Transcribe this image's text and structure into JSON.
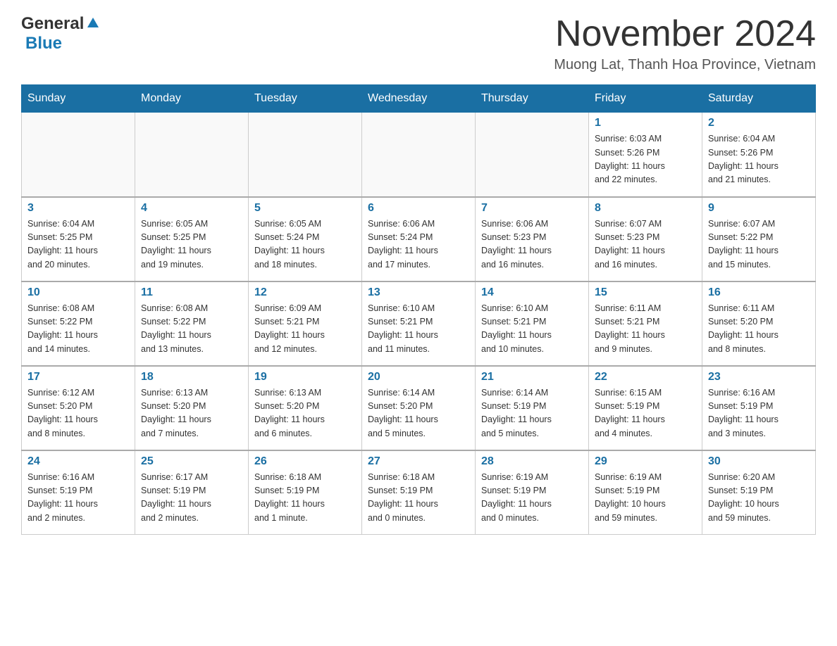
{
  "logo": {
    "text_general": "General",
    "text_blue": "Blue"
  },
  "header": {
    "month_year": "November 2024",
    "location": "Muong Lat, Thanh Hoa Province, Vietnam"
  },
  "weekdays": [
    "Sunday",
    "Monday",
    "Tuesday",
    "Wednesday",
    "Thursday",
    "Friday",
    "Saturday"
  ],
  "weeks": [
    [
      {
        "day": "",
        "info": ""
      },
      {
        "day": "",
        "info": ""
      },
      {
        "day": "",
        "info": ""
      },
      {
        "day": "",
        "info": ""
      },
      {
        "day": "",
        "info": ""
      },
      {
        "day": "1",
        "info": "Sunrise: 6:03 AM\nSunset: 5:26 PM\nDaylight: 11 hours\nand 22 minutes."
      },
      {
        "day": "2",
        "info": "Sunrise: 6:04 AM\nSunset: 5:26 PM\nDaylight: 11 hours\nand 21 minutes."
      }
    ],
    [
      {
        "day": "3",
        "info": "Sunrise: 6:04 AM\nSunset: 5:25 PM\nDaylight: 11 hours\nand 20 minutes."
      },
      {
        "day": "4",
        "info": "Sunrise: 6:05 AM\nSunset: 5:25 PM\nDaylight: 11 hours\nand 19 minutes."
      },
      {
        "day": "5",
        "info": "Sunrise: 6:05 AM\nSunset: 5:24 PM\nDaylight: 11 hours\nand 18 minutes."
      },
      {
        "day": "6",
        "info": "Sunrise: 6:06 AM\nSunset: 5:24 PM\nDaylight: 11 hours\nand 17 minutes."
      },
      {
        "day": "7",
        "info": "Sunrise: 6:06 AM\nSunset: 5:23 PM\nDaylight: 11 hours\nand 16 minutes."
      },
      {
        "day": "8",
        "info": "Sunrise: 6:07 AM\nSunset: 5:23 PM\nDaylight: 11 hours\nand 16 minutes."
      },
      {
        "day": "9",
        "info": "Sunrise: 6:07 AM\nSunset: 5:22 PM\nDaylight: 11 hours\nand 15 minutes."
      }
    ],
    [
      {
        "day": "10",
        "info": "Sunrise: 6:08 AM\nSunset: 5:22 PM\nDaylight: 11 hours\nand 14 minutes."
      },
      {
        "day": "11",
        "info": "Sunrise: 6:08 AM\nSunset: 5:22 PM\nDaylight: 11 hours\nand 13 minutes."
      },
      {
        "day": "12",
        "info": "Sunrise: 6:09 AM\nSunset: 5:21 PM\nDaylight: 11 hours\nand 12 minutes."
      },
      {
        "day": "13",
        "info": "Sunrise: 6:10 AM\nSunset: 5:21 PM\nDaylight: 11 hours\nand 11 minutes."
      },
      {
        "day": "14",
        "info": "Sunrise: 6:10 AM\nSunset: 5:21 PM\nDaylight: 11 hours\nand 10 minutes."
      },
      {
        "day": "15",
        "info": "Sunrise: 6:11 AM\nSunset: 5:21 PM\nDaylight: 11 hours\nand 9 minutes."
      },
      {
        "day": "16",
        "info": "Sunrise: 6:11 AM\nSunset: 5:20 PM\nDaylight: 11 hours\nand 8 minutes."
      }
    ],
    [
      {
        "day": "17",
        "info": "Sunrise: 6:12 AM\nSunset: 5:20 PM\nDaylight: 11 hours\nand 8 minutes."
      },
      {
        "day": "18",
        "info": "Sunrise: 6:13 AM\nSunset: 5:20 PM\nDaylight: 11 hours\nand 7 minutes."
      },
      {
        "day": "19",
        "info": "Sunrise: 6:13 AM\nSunset: 5:20 PM\nDaylight: 11 hours\nand 6 minutes."
      },
      {
        "day": "20",
        "info": "Sunrise: 6:14 AM\nSunset: 5:20 PM\nDaylight: 11 hours\nand 5 minutes."
      },
      {
        "day": "21",
        "info": "Sunrise: 6:14 AM\nSunset: 5:19 PM\nDaylight: 11 hours\nand 5 minutes."
      },
      {
        "day": "22",
        "info": "Sunrise: 6:15 AM\nSunset: 5:19 PM\nDaylight: 11 hours\nand 4 minutes."
      },
      {
        "day": "23",
        "info": "Sunrise: 6:16 AM\nSunset: 5:19 PM\nDaylight: 11 hours\nand 3 minutes."
      }
    ],
    [
      {
        "day": "24",
        "info": "Sunrise: 6:16 AM\nSunset: 5:19 PM\nDaylight: 11 hours\nand 2 minutes."
      },
      {
        "day": "25",
        "info": "Sunrise: 6:17 AM\nSunset: 5:19 PM\nDaylight: 11 hours\nand 2 minutes."
      },
      {
        "day": "26",
        "info": "Sunrise: 6:18 AM\nSunset: 5:19 PM\nDaylight: 11 hours\nand 1 minute."
      },
      {
        "day": "27",
        "info": "Sunrise: 6:18 AM\nSunset: 5:19 PM\nDaylight: 11 hours\nand 0 minutes."
      },
      {
        "day": "28",
        "info": "Sunrise: 6:19 AM\nSunset: 5:19 PM\nDaylight: 11 hours\nand 0 minutes."
      },
      {
        "day": "29",
        "info": "Sunrise: 6:19 AM\nSunset: 5:19 PM\nDaylight: 10 hours\nand 59 minutes."
      },
      {
        "day": "30",
        "info": "Sunrise: 6:20 AM\nSunset: 5:19 PM\nDaylight: 10 hours\nand 59 minutes."
      }
    ]
  ]
}
